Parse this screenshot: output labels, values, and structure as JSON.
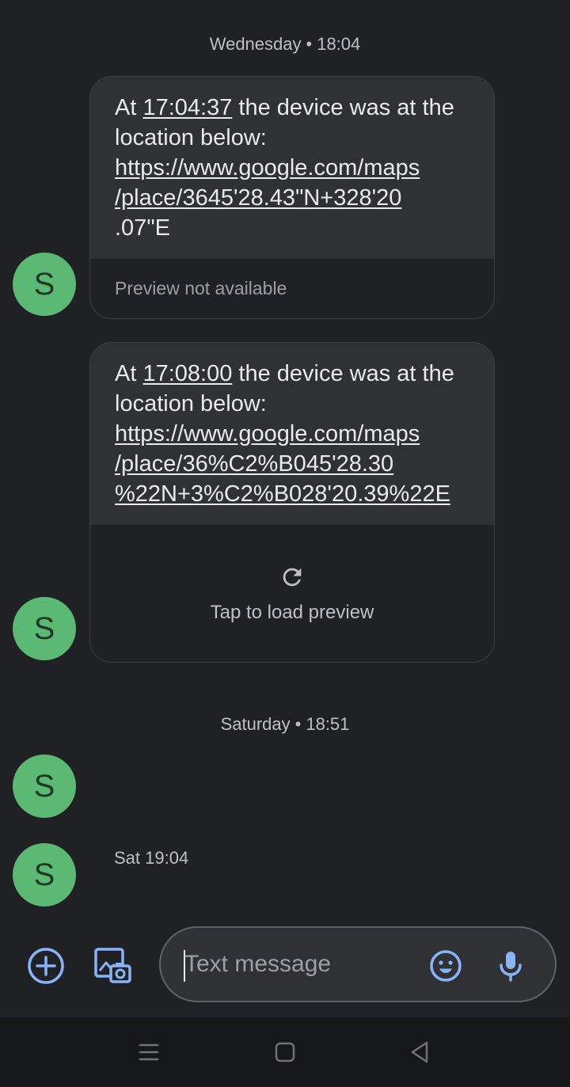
{
  "conversation": {
    "date_separators": [
      {
        "day": "Wednesday",
        "dot": "•",
        "time": "18:04"
      },
      {
        "day": "Saturday",
        "dot": "•",
        "time": "18:51"
      }
    ],
    "avatar_initial": "S",
    "messages": [
      {
        "prefix": "At ",
        "time_link": "17:04:37",
        "body": " the device was at the location below:",
        "url_lines": [
          "https://www.google.com/maps",
          "/place/3645'28.43\"N+328'20",
          ".07\"E"
        ],
        "preview": "Preview not available"
      },
      {
        "prefix": "At ",
        "time_link": "17:08:00",
        "body": " the device was at the location below:",
        "url_lines": [
          "https://www.google.com/maps",
          "/place/36%C2%B045'28.30",
          "%22N+3%C2%B028'20.39%22E"
        ],
        "preview": "Tap to load preview"
      }
    ],
    "last_message_time": "Sat 19:04"
  },
  "composer": {
    "placeholder": "Text message"
  },
  "colors": {
    "background": "#202124",
    "bubble": "#303134",
    "avatar": "#5bb974",
    "accent_icon": "#8ab4f8"
  }
}
